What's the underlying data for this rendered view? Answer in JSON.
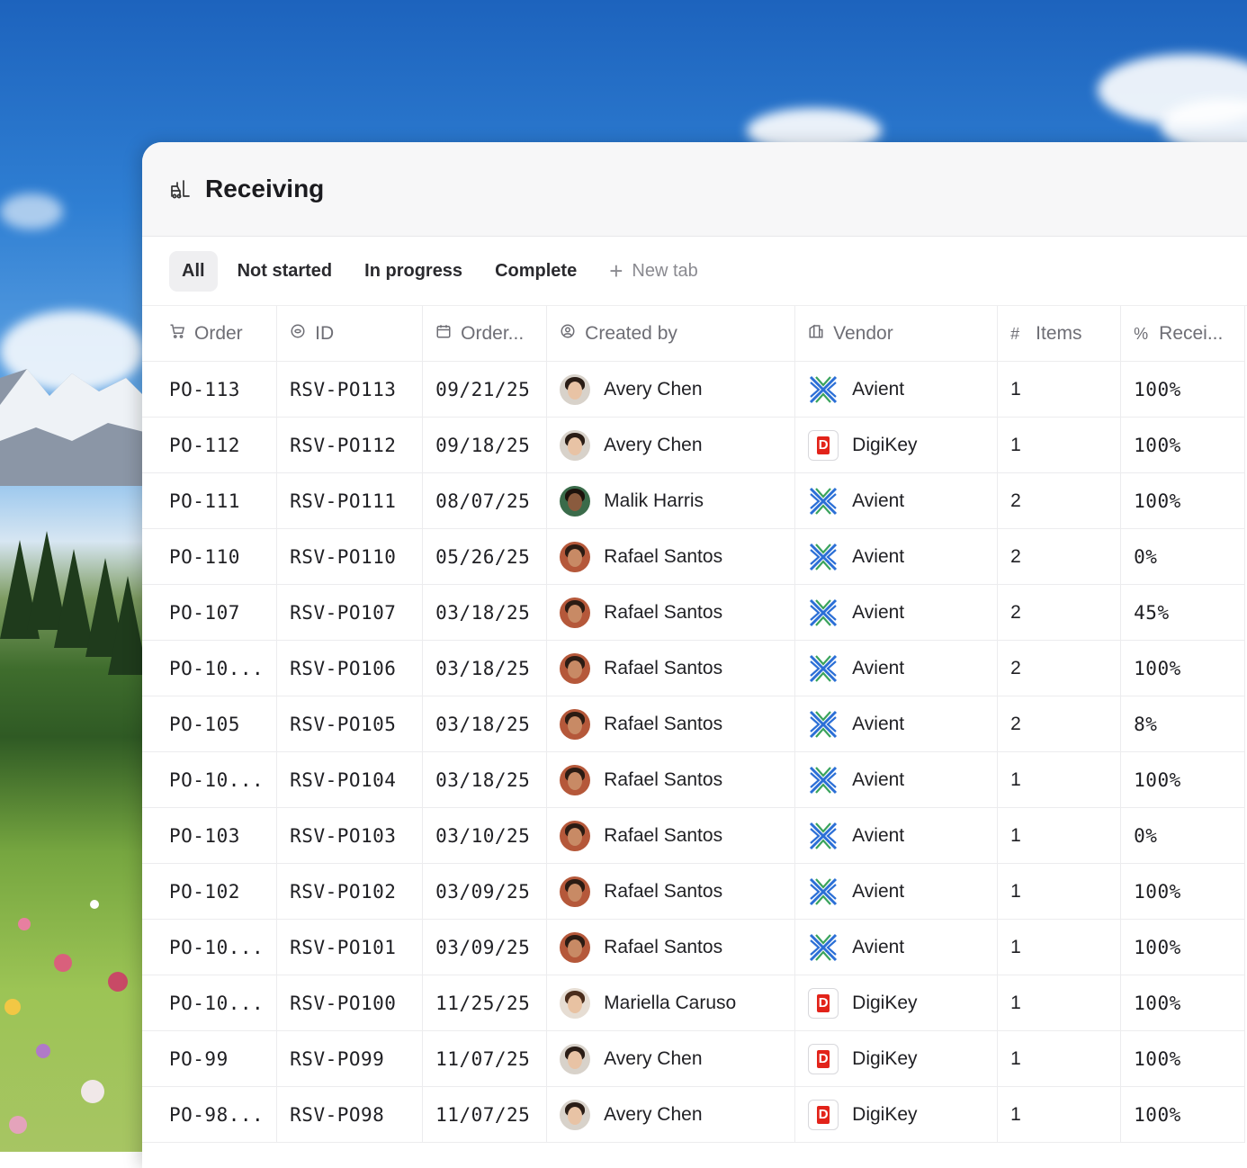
{
  "app": {
    "title": "Receiving",
    "title_icon": "forklift-icon"
  },
  "tabs": [
    {
      "label": "All",
      "active": true
    },
    {
      "label": "Not started",
      "active": false
    },
    {
      "label": "In progress",
      "active": false
    },
    {
      "label": "Complete",
      "active": false
    }
  ],
  "new_tab_label": "New tab",
  "columns": [
    {
      "label": "Order",
      "icon": "cart-icon"
    },
    {
      "label": "ID",
      "icon": "id-icon"
    },
    {
      "label": "Order...",
      "icon": "calendar-icon"
    },
    {
      "label": "Created by",
      "icon": "user-circle-icon"
    },
    {
      "label": "Vendor",
      "icon": "building-icon"
    },
    {
      "label": "Items",
      "icon": "hash-icon"
    },
    {
      "label": "Recei...",
      "icon": "percent-icon"
    }
  ],
  "rows": [
    {
      "order": "PO-113",
      "id": "RSV-PO113",
      "date": "09/21/25",
      "creator": "Avery Chen",
      "avatar": "avery",
      "vendor": "Avient",
      "vendor_logo": "avient",
      "items": "1",
      "received": "100%"
    },
    {
      "order": "PO-112",
      "id": "RSV-PO112",
      "date": "09/18/25",
      "creator": "Avery Chen",
      "avatar": "avery",
      "vendor": "DigiKey",
      "vendor_logo": "digikey",
      "items": "1",
      "received": "100%"
    },
    {
      "order": "PO-111",
      "id": "RSV-PO111",
      "date": "08/07/25",
      "creator": "Malik Harris",
      "avatar": "malik",
      "vendor": "Avient",
      "vendor_logo": "avient",
      "items": "2",
      "received": "100%"
    },
    {
      "order": "PO-110",
      "id": "RSV-PO110",
      "date": "05/26/25",
      "creator": "Rafael Santos",
      "avatar": "rafael",
      "vendor": "Avient",
      "vendor_logo": "avient",
      "items": "2",
      "received": "0%"
    },
    {
      "order": "PO-107",
      "id": "RSV-PO107",
      "date": "03/18/25",
      "creator": "Rafael Santos",
      "avatar": "rafael",
      "vendor": "Avient",
      "vendor_logo": "avient",
      "items": "2",
      "received": "45%"
    },
    {
      "order": "PO-10...",
      "id": "RSV-PO106",
      "date": "03/18/25",
      "creator": "Rafael Santos",
      "avatar": "rafael",
      "vendor": "Avient",
      "vendor_logo": "avient",
      "items": "2",
      "received": "100%"
    },
    {
      "order": "PO-105",
      "id": "RSV-PO105",
      "date": "03/18/25",
      "creator": "Rafael Santos",
      "avatar": "rafael",
      "vendor": "Avient",
      "vendor_logo": "avient",
      "items": "2",
      "received": "8%"
    },
    {
      "order": "PO-10...",
      "id": "RSV-PO104",
      "date": "03/18/25",
      "creator": "Rafael Santos",
      "avatar": "rafael",
      "vendor": "Avient",
      "vendor_logo": "avient",
      "items": "1",
      "received": "100%"
    },
    {
      "order": "PO-103",
      "id": "RSV-PO103",
      "date": "03/10/25",
      "creator": "Rafael Santos",
      "avatar": "rafael",
      "vendor": "Avient",
      "vendor_logo": "avient",
      "items": "1",
      "received": "0%"
    },
    {
      "order": "PO-102",
      "id": "RSV-PO102",
      "date": "03/09/25",
      "creator": "Rafael Santos",
      "avatar": "rafael",
      "vendor": "Avient",
      "vendor_logo": "avient",
      "items": "1",
      "received": "100%"
    },
    {
      "order": "PO-10...",
      "id": "RSV-PO101",
      "date": "03/09/25",
      "creator": "Rafael Santos",
      "avatar": "rafael",
      "vendor": "Avient",
      "vendor_logo": "avient",
      "items": "1",
      "received": "100%"
    },
    {
      "order": "PO-10...",
      "id": "RSV-PO100",
      "date": "11/25/25",
      "creator": "Mariella Caruso",
      "avatar": "mariella",
      "vendor": "DigiKey",
      "vendor_logo": "digikey",
      "items": "1",
      "received": "100%"
    },
    {
      "order": "PO-99",
      "id": "RSV-PO99",
      "date": "11/07/25",
      "creator": "Avery Chen",
      "avatar": "avery",
      "vendor": "DigiKey",
      "vendor_logo": "digikey",
      "items": "1",
      "received": "100%"
    },
    {
      "order": "PO-98...",
      "id": "RSV-PO98",
      "date": "11/07/25",
      "creator": "Avery Chen",
      "avatar": "avery",
      "vendor": "DigiKey",
      "vendor_logo": "digikey",
      "items": "1",
      "received": "100%"
    }
  ],
  "colors": {
    "avient_blue": "#2b6fd6",
    "avient_green": "#3aa35c",
    "digikey_red": "#e2231a"
  }
}
